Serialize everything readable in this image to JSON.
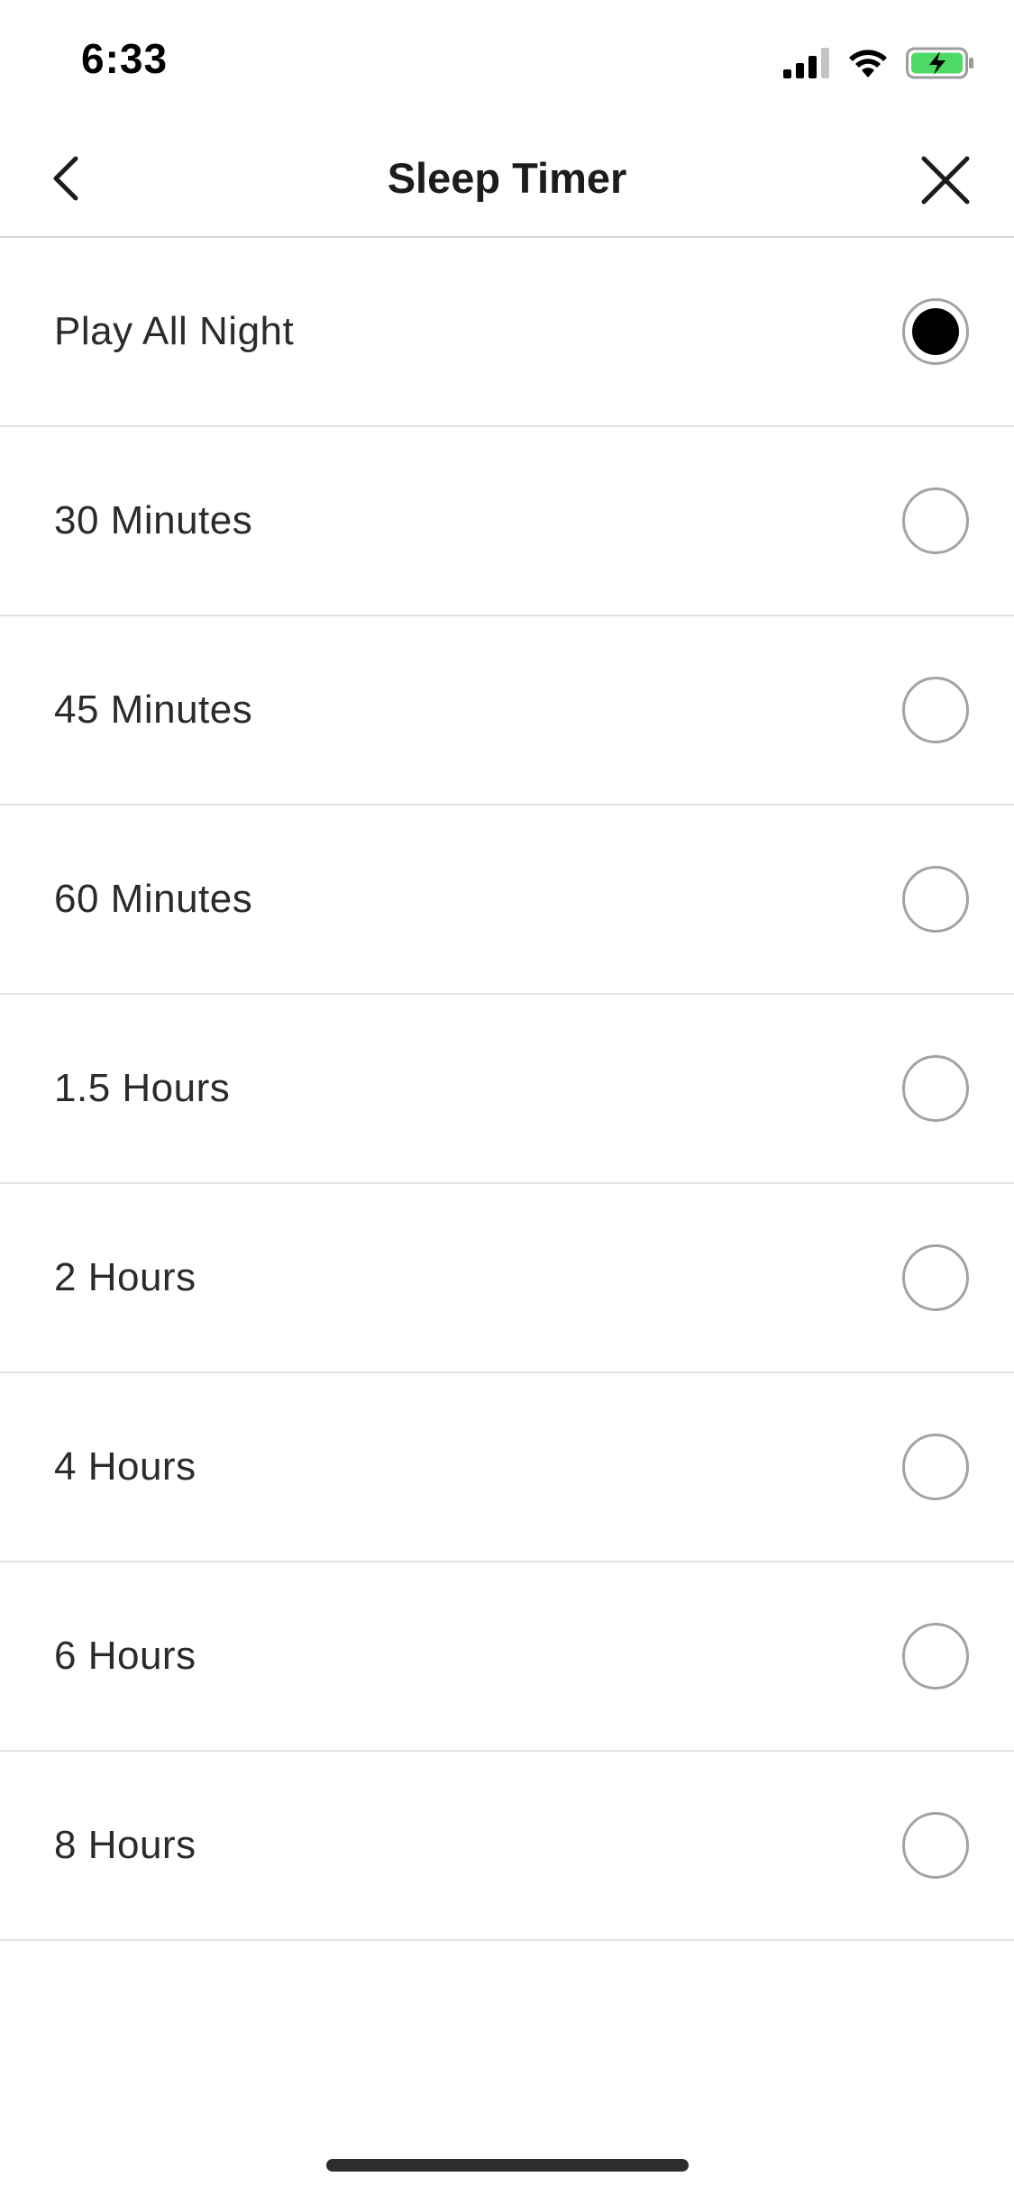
{
  "status_bar": {
    "time": "6:33",
    "icons": [
      "signal-icon",
      "wifi-icon",
      "battery-charging-icon"
    ],
    "battery_color": "#4cd964"
  },
  "header": {
    "title": "Sleep Timer",
    "back_icon": "chevron-left-icon",
    "close_icon": "close-icon"
  },
  "options": [
    {
      "label": "Play All Night",
      "selected": true
    },
    {
      "label": "30 Minutes",
      "selected": false
    },
    {
      "label": "45 Minutes",
      "selected": false
    },
    {
      "label": "60 Minutes",
      "selected": false
    },
    {
      "label": "1.5 Hours",
      "selected": false
    },
    {
      "label": "2 Hours",
      "selected": false
    },
    {
      "label": "4 Hours",
      "selected": false
    },
    {
      "label": "6 Hours",
      "selected": false
    },
    {
      "label": "8 Hours",
      "selected": false
    }
  ]
}
